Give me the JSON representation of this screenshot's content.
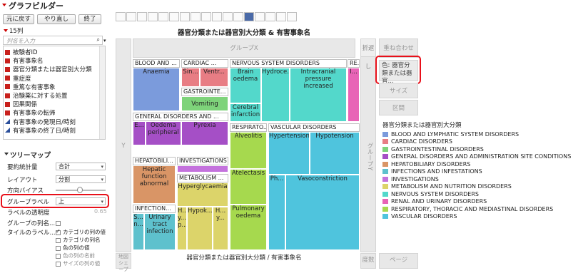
{
  "window": {
    "title": "グラフビルダー"
  },
  "toolbar": {
    "undo": "元に戻す",
    "redo": "やり直し",
    "done": "終了"
  },
  "columns": {
    "count_label": "15列",
    "search_placeholder": "列名を入力",
    "items": [
      {
        "label": "被験者ID",
        "type": "nominal"
      },
      {
        "label": "有害事象名",
        "type": "nominal"
      },
      {
        "label": "器官分類または器官別大分類",
        "type": "nominal"
      },
      {
        "label": "重症度",
        "type": "nominal"
      },
      {
        "label": "重篤な有害事象",
        "type": "nominal"
      },
      {
        "label": "治験薬に対する処置",
        "type": "nominal"
      },
      {
        "label": "因果関係",
        "type": "nominal"
      },
      {
        "label": "有害事象の転帰",
        "type": "nominal"
      },
      {
        "label": "有害事象の発現日/時刻",
        "type": "continuous"
      },
      {
        "label": "有害事象の終了日/時刻",
        "type": "continuous"
      }
    ]
  },
  "treemap_panel": {
    "title": "ツリーマップ",
    "summary_stat_label": "要約統計量",
    "summary_stat_value": "合計",
    "layout_label": "レイアウト",
    "layout_value": "分割",
    "bias_label": "方向バイアス",
    "group_label_label": "グループラベル",
    "group_label_value": "上",
    "label_opacity_label": "ラベルの透明度",
    "label_opacity_value": "0.65",
    "group_colname_label": "グループの列名...",
    "tile_label_label": "タイルのラベル...",
    "options": [
      {
        "label": "カテゴリの列の値",
        "checked": true
      },
      {
        "label": "カテゴリの列名",
        "checked": false
      },
      {
        "label": "色の列の値",
        "checked": false
      },
      {
        "label": "色の列の名前",
        "checked": false
      },
      {
        "label": "サイズの列の値",
        "checked": false
      }
    ]
  },
  "graph": {
    "title": "器官分類または器官別大分類 & 有害事象名",
    "group_x": "グループX",
    "group_y": "グループY",
    "wrap": "折返し",
    "overlay": "重ね合わせ",
    "color_role": "色: 器官分類または器官...",
    "size": "サイズ",
    "section": "区間",
    "y_label": "Y",
    "x_label": "器官分類または器官別大分類 / 有害事象名",
    "freq": "度数",
    "page": "ページ",
    "map_shape": "地図シェープ",
    "headers": {
      "blood": "BLOOD AND ...",
      "cardiac": "CARDIAC ...",
      "gastro": "GASTROINTE...",
      "nervous": "NERVOUS SYSTEM DISORDERS",
      "re": "RE...",
      "general": "GENERAL DISORDERS AND ...",
      "respiratory": "RESPIRATO...",
      "vascular": "VASCULAR DISORDERS",
      "hepato": "HEPATOBILI...",
      "investigations": "INVESTIGATIONS",
      "metabolism": "METABOLISM ...",
      "infection": "INFECTION..."
    },
    "tiles": {
      "anaemia": "Anaemia",
      "sin": "Sin...",
      "ventr": "Ventr...",
      "vomiting": "Vomiting",
      "brain": "Brain oedema",
      "hydroce": "Hydroce...",
      "intracranial": "Intracranial pressure increased",
      "cerebral": "Cerebral infarction",
      "i_re": "I...",
      "e_gen": "E...",
      "oedema_per": "Oedema peripheral",
      "pyrexia": "Pyrexia",
      "alveolitis": "Alveolitis",
      "atelectasis": "Atelectasis",
      "pulmonary": "Pulmonary oedema",
      "hypertension": "Hypertension",
      "hypotension": "Hypotension",
      "ph": "Ph...",
      "vasoconstriction": "Vasoconstriction",
      "hepatic": "Hepatic function abnormal",
      "hyperglycaemia": "Hyperglycaemia",
      "s_inf": "S... n...",
      "urinary": "Urinary tract infection",
      "hypok": "Hypok...",
      "h_small": "H... y... p...",
      "h_small2": "H... y..."
    }
  },
  "legend": {
    "title": "器官分類または器官別大分類",
    "items": [
      {
        "label": "BLOOD AND LYMPHATIC SYSTEM DISORDERS",
        "color": "#7b9bdc"
      },
      {
        "label": "CARDIAC DISORDERS",
        "color": "#e87d84"
      },
      {
        "label": "GASTROINTESTINAL DISORDERS",
        "color": "#7ed37a"
      },
      {
        "label": "GENERAL DISORDERS AND ADMINISTRATION SITE CONDITIONS",
        "color": "#a54fc6"
      },
      {
        "label": "HEPATOBILIARY DISORDERS",
        "color": "#d99566"
      },
      {
        "label": "INFECTIONS AND INFESTATIONS",
        "color": "#5ec1cd"
      },
      {
        "label": "INVESTIGATIONS",
        "color": "#c472dd"
      },
      {
        "label": "METABOLISM AND NUTRITION DISORDERS",
        "color": "#dcd46a"
      },
      {
        "label": "NERVOUS SYSTEM DISORDERS",
        "color": "#53d8cb"
      },
      {
        "label": "RENAL AND URINARY DISORDERS",
        "color": "#e864b6"
      },
      {
        "label": "RESPIRATORY, THORACIC AND MEDIASTINAL DISORDERS",
        "color": "#a6d94e"
      },
      {
        "label": "VASCULAR DISORDERS",
        "color": "#4fc4dd"
      }
    ]
  }
}
